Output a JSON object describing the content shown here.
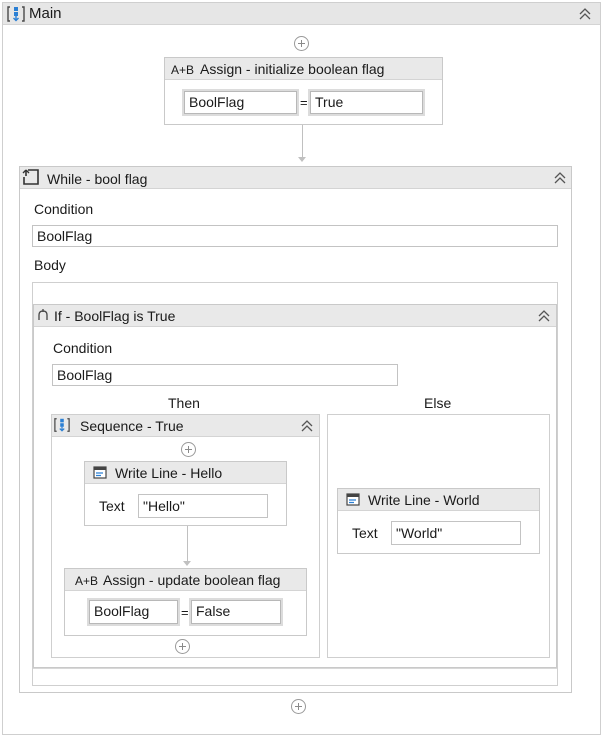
{
  "main": {
    "title": "Main"
  },
  "assign_init": {
    "prefix": "A+B",
    "title": "Assign - initialize boolean flag",
    "left": "BoolFlag",
    "op": "=",
    "right": "True"
  },
  "while": {
    "title": "While - bool flag",
    "condition_label": "Condition",
    "condition_value": "BoolFlag",
    "body_label": "Body"
  },
  "if": {
    "title": "If - BoolFlag is True",
    "condition_label": "Condition",
    "condition_value": "BoolFlag",
    "then_label": "Then",
    "else_label": "Else"
  },
  "sequence_true": {
    "title": "Sequence - True"
  },
  "writeline_hello": {
    "title": "Write Line - Hello",
    "text_label": "Text",
    "text_value": "\"Hello\""
  },
  "assign_update": {
    "prefix": "A+B",
    "title": "Assign - update boolean flag",
    "left": "BoolFlag",
    "op": "=",
    "right": "False"
  },
  "writeline_world": {
    "title": "Write Line - World",
    "text_label": "Text",
    "text_value": "\"World\""
  }
}
